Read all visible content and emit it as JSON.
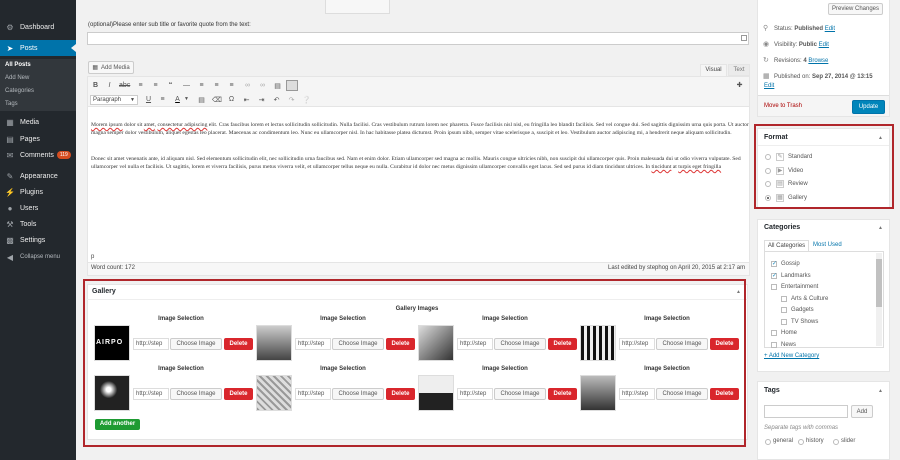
{
  "sidebar": {
    "dashboard": "Dashboard",
    "posts": "Posts",
    "sub": [
      "All Posts",
      "Add New",
      "Categories",
      "Tags"
    ],
    "media": "Media",
    "pages": "Pages",
    "comments": "Comments",
    "comments_count": "119",
    "appearance": "Appearance",
    "plugins": "Plugins",
    "users": "Users",
    "tools": "Tools",
    "settings": "Settings",
    "collapse": "Collapse menu"
  },
  "subtitle": {
    "label": "(optional)Please enter sub title or favorite quote from the text:"
  },
  "editor": {
    "add_media": "Add Media",
    "tab_visual": "Visual",
    "tab_text": "Text",
    "format_select": "Paragraph",
    "para1_a": "Morem ipsum",
    "para1_b": " dolor sit ",
    "para1_c": "amet",
    "para1_d": ", ",
    "para1_e": "consectetur adipiscing",
    "para1_f": " elit. Cras faucibus lorem et lectus sollicitudin sollicitudin. Nulla facilisi. Cras vestibulum rutrum lorem nec pharetra. Fusce facilisis nisl nisl, eu fringilla leo blandit facilisis. Sed vel congue dui. Sed sagittis dignissim urna quis porta. Ut auctor magna semper dolor vestibulum, aliquet egestas leo placerat. Maecenas ac condimentum leo. Nunc eu ullamcorper nisl. In hac habitasse platea dictumst. Proin ipsum nibh, semper vitae scelerisque a, suscipit et leo. Vestibulum auctor adipiscing mi, a hendrerit neque aliquam sollicitudin.",
    "para2_a": "Donec sit amet venenatis ante, id aliquam nisl. Sed elementum sollicitudin elit, nec sollicitudin urna faucibus sed. Nam et enim dolor. Etiam ullamcorper sed magna ac mollis. Mauris congue ultricies nibh, non suscipit dui ullamcorper quis. Proin malesuada dui ut odio viverra vulputate. Sed ullamcorper vel nulla et facilisis. Ut sagittis, lorem et viverra facilisis, purus metus viverra velit, et ullamcorper tellus neque eu nulla. Curabitur id dolor nec metus dignissim ullamcorper convallis eget lacus. Sed sed purus id diam tincidunt ultrices. In ",
    "para2_b": "tincidunt",
    "para2_c": " at ",
    "para2_d": "turpis eget fringilla",
    "path": "p",
    "word_count": "Word count: 172",
    "last_edited": "Last edited by stephog on April 20, 2015 at 2:17 am"
  },
  "gallery": {
    "title": "Gallery",
    "images_label": "Gallery Images",
    "selection_label": "Image Selection",
    "url_value": "http://step",
    "choose_label": "Choose Image",
    "delete_label": "Delete",
    "add_another": "Add another"
  },
  "publish": {
    "preview_changes": "Preview Changes",
    "status_label": "Status: ",
    "status_value": "Published",
    "visibility_label": "Visibility: ",
    "visibility_value": "Public",
    "revisions_label": "Revisions: ",
    "revisions_value": "4",
    "browse": "Browse",
    "published_on_label": "Published on: ",
    "published_on_value": "Sep 27, 2014 @ 13:15",
    "edit": "Edit",
    "trash": "Move to Trash",
    "update": "Update"
  },
  "format": {
    "title": "Format",
    "options": [
      "Standard",
      "Video",
      "Review",
      "Gallery"
    ],
    "selected": "Gallery"
  },
  "categories": {
    "title": "Categories",
    "tab_all": "All Categories",
    "tab_most": "Most Used",
    "items": [
      {
        "label": "Gossip",
        "checked": true,
        "indent": false
      },
      {
        "label": "Landmarks",
        "checked": true,
        "indent": false
      },
      {
        "label": "Entertainment",
        "checked": false,
        "indent": false
      },
      {
        "label": "Arts & Culture",
        "checked": false,
        "indent": true
      },
      {
        "label": "Gadgets",
        "checked": false,
        "indent": true
      },
      {
        "label": "TV Shows",
        "checked": false,
        "indent": true
      },
      {
        "label": "Home",
        "checked": false,
        "indent": false
      },
      {
        "label": "News",
        "checked": false,
        "indent": false
      }
    ],
    "add_new": "+ Add New Category"
  },
  "tags": {
    "title": "Tags",
    "add": "Add",
    "hint": "Separate tags with commas",
    "options": [
      "general",
      "history",
      "slider"
    ]
  },
  "colors": {
    "accent": "#0073aa",
    "highlight": "#b0262b",
    "delete": "#d9262c",
    "add_another": "#1e9b32"
  }
}
